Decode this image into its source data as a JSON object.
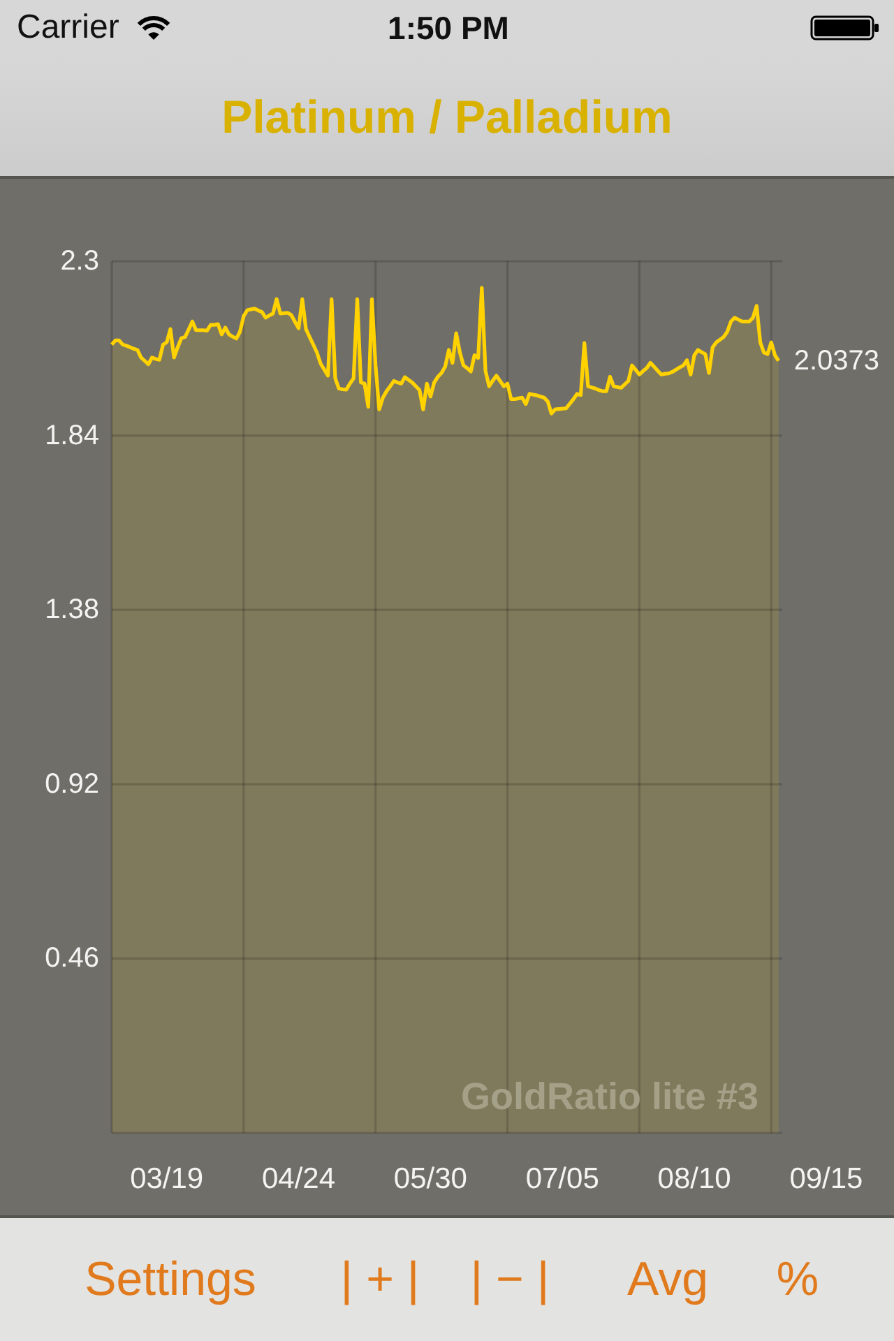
{
  "status_bar": {
    "carrier": "Carrier",
    "time": "1:50 PM"
  },
  "navigation_bar": {
    "title": "Platinum / Palladium"
  },
  "chart": {
    "caption": "GoldRatio lite #3",
    "chart_data": {
      "type": "area",
      "categories": [
        null,
        null,
        null,
        null,
        null,
        null,
        null,
        null,
        null,
        null,
        null,
        null,
        null,
        null,
        null,
        "03/19",
        null,
        null,
        null,
        null,
        null,
        null,
        null,
        null,
        null,
        null,
        null,
        null,
        null,
        null,
        null,
        null,
        null,
        null,
        null,
        null,
        null,
        null,
        null,
        null,
        null,
        null,
        null,
        null,
        null,
        null,
        null,
        null,
        null,
        null,
        null,
        "04/24",
        null,
        null,
        null,
        null,
        null,
        null,
        null,
        null,
        null,
        null,
        null,
        null,
        null,
        null,
        null,
        null,
        null,
        null,
        null,
        null,
        null,
        null,
        null,
        null,
        null,
        null,
        null,
        null,
        null,
        null,
        null,
        null,
        null,
        null,
        null,
        "05/30",
        null,
        null,
        null,
        null,
        null,
        null,
        null,
        null,
        null,
        null,
        null,
        null,
        null,
        null,
        null,
        null,
        null,
        null,
        null,
        null,
        null,
        null,
        null,
        null,
        null,
        null,
        null,
        null,
        null,
        null,
        null,
        null,
        null,
        null,
        null,
        "07/05",
        null,
        null,
        null,
        null,
        null,
        null,
        null,
        null,
        null,
        null,
        null,
        null,
        null,
        null,
        null,
        null,
        null,
        null,
        null,
        null,
        null,
        null,
        null,
        null,
        null,
        null,
        null,
        null,
        null,
        null,
        null,
        null,
        null,
        null,
        null,
        "08/10",
        null,
        null,
        null,
        null,
        null,
        null,
        null,
        null,
        null,
        null,
        null,
        null,
        null,
        null,
        null,
        null,
        null,
        null,
        null,
        null,
        null,
        null,
        null,
        null,
        null,
        null,
        null,
        null,
        null,
        null,
        null,
        null,
        null,
        null,
        null,
        "09/15"
      ],
      "series": [
        {
          "color": "#ffd200",
          "values": [
            2.08,
            2.091,
            2.091,
            2.08,
            2.077,
            2.073,
            2.069,
            2.066,
            2.046,
            2.037,
            2.028,
            2.046,
            2.042,
            2.04,
            2.08,
            2.086,
            2.121,
            2.046,
            2.073,
            2.097,
            2.1,
            2.12,
            2.141,
            2.118,
            2.118,
            2.118,
            2.117,
            2.132,
            2.132,
            2.134,
            2.107,
            2.125,
            2.107,
            2.101,
            2.096,
            2.114,
            2.155,
            2.171,
            2.173,
            2.175,
            2.17,
            2.166,
            2.151,
            2.157,
            2.162,
            2.2,
            2.162,
            2.163,
            2.164,
            2.158,
            2.14,
            2.123,
            2.2,
            2.121,
            2.1,
            2.08,
            2.059,
            2.03,
            2.014,
            1.998,
            2.2,
            1.991,
            1.964,
            1.962,
            1.961,
            1.977,
            1.991,
            2.2,
            1.98,
            1.977,
            1.916,
            2.2,
            2.025,
            1.909,
            1.94,
            1.957,
            1.97,
            1.984,
            1.98,
            1.977,
            1.994,
            1.987,
            1.98,
            1.97,
            1.96,
            1.909,
            1.977,
            1.943,
            1.98,
            1.995,
            2.005,
            2.022,
            2.066,
            2.032,
            2.11,
            2.06,
            2.025,
            2.018,
            2.009,
            2.052,
            2.045,
            2.23,
            2.011,
            1.97,
            1.985,
            1.998,
            1.984,
            1.97,
            1.977,
            1.936,
            1.936,
            1.938,
            1.94,
            1.923,
            1.95,
            1.948,
            1.946,
            1.943,
            1.94,
            1.93,
            1.898,
            1.909,
            1.91,
            1.911,
            1.912,
            1.924,
            1.936,
            1.95,
            1.947,
            2.084,
            1.97,
            1.967,
            1.964,
            1.96,
            1.957,
            1.957,
            1.995,
            1.97,
            1.968,
            1.966,
            1.975,
            1.984,
            2.025,
            2.013,
            2.001,
            2.01,
            2.018,
            2.032,
            2.022,
            2.011,
            2.001,
            2.003,
            2.004,
            2.008,
            2.014,
            2.02,
            2.025,
            2.039,
            2.001,
            2.052,
            2.066,
            2.06,
            2.055,
            2.005,
            2.073,
            2.086,
            2.093,
            2.1,
            2.114,
            2.141,
            2.151,
            2.146,
            2.141,
            2.141,
            2.141,
            2.151,
            2.182,
            2.086,
            2.059,
            2.055,
            2.086,
            2.052,
            2.037,
            null,
            null,
            null,
            null,
            null,
            null,
            null,
            null,
            null,
            null,
            null,
            null,
            null
          ]
        }
      ],
      "ylim": [
        0,
        2.3
      ],
      "yticks": [
        0.46,
        0.92,
        1.38,
        1.84,
        2.3
      ],
      "grid": true,
      "annotations": [
        "2.0373"
      ]
    }
  },
  "toolbar": {
    "items": [
      "Settings",
      "| + |",
      "| − |",
      "Avg",
      "%"
    ]
  }
}
